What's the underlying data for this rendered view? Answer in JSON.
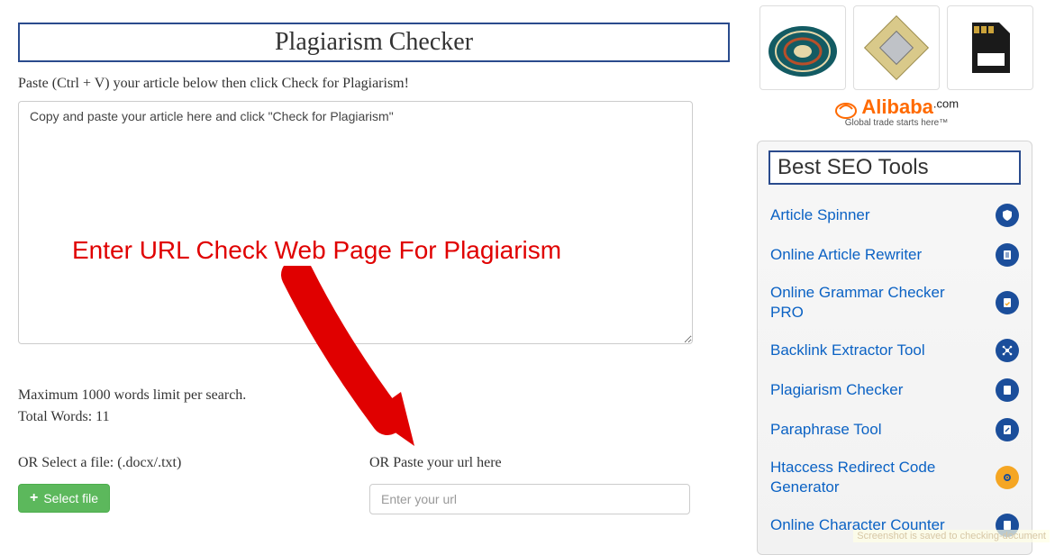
{
  "main": {
    "title": "Plagiarism Checker",
    "instruction": "Paste (Ctrl + V) your article below then click Check for Plagiarism!",
    "textarea_value": "Copy and paste your article here and click \"Check for Plagiarism\"",
    "max_limit": "Maximum 1000 words limit per search.",
    "total_words": "Total Words: 11",
    "select_file_label": "OR Select a file: (.docx/.txt)",
    "select_file_button": "Select file",
    "paste_url_label": "OR Paste your url here",
    "url_placeholder": "Enter your url",
    "annotation_text": "Enter URL Check Web Page For Plagiarism"
  },
  "sidebar": {
    "alibaba_name": "Alibaba",
    "alibaba_com": ".com",
    "alibaba_tag": "Global trade starts here™",
    "tools_header": "Best SEO Tools",
    "tools": [
      {
        "label": "Article Spinner",
        "icon": "shield"
      },
      {
        "label": "Online Article Rewriter",
        "icon": "doc-lines"
      },
      {
        "label": "Online Grammar Checker PRO",
        "icon": "doc-check"
      },
      {
        "label": "Backlink Extractor Tool",
        "icon": "nodes"
      },
      {
        "label": "Plagiarism Checker",
        "icon": "page"
      },
      {
        "label": "Paraphrase Tool",
        "icon": "edit"
      },
      {
        "label": "Htaccess Redirect Code Generator",
        "icon": "gear-orange"
      },
      {
        "label": "Online Character Counter",
        "icon": "page"
      }
    ]
  },
  "screenshot_note": "Screenshot is saved to checking-document"
}
